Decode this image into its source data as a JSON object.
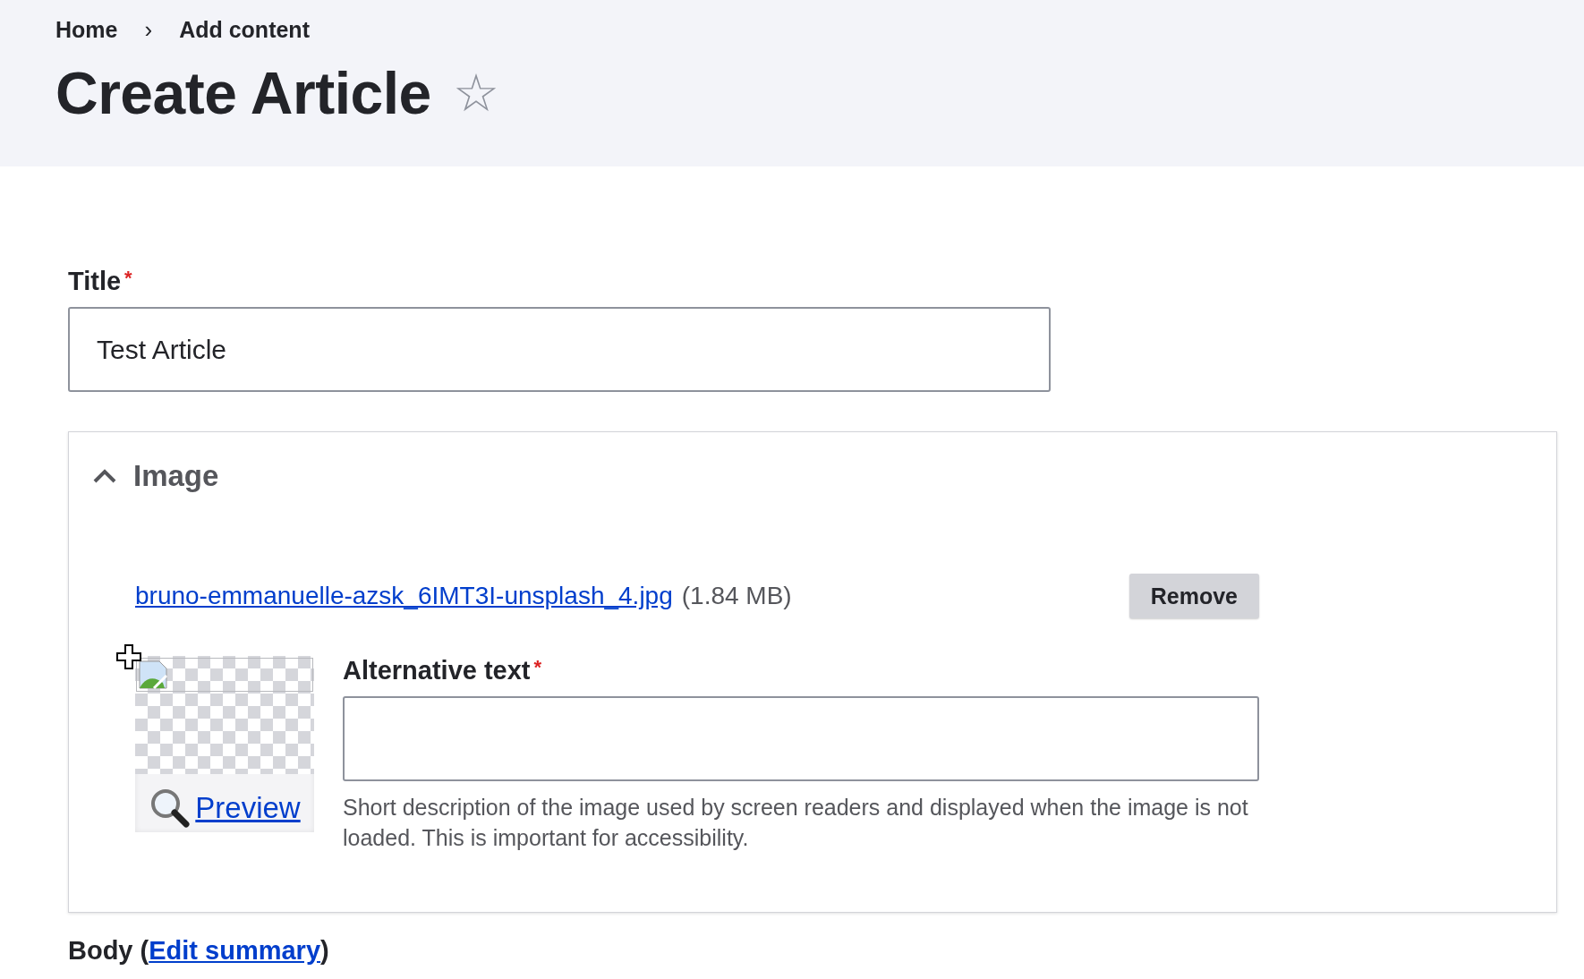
{
  "breadcrumb": [
    "Home",
    "Add content"
  ],
  "breadcrumb_separator": "›",
  "page_title": "Create Article",
  "favorite": {
    "on": false,
    "glyph": "☆"
  },
  "title_field": {
    "label": "Title",
    "required": true,
    "required_mark": "*",
    "value": "Test Article"
  },
  "image_section": {
    "title": "Image",
    "expanded": true,
    "file": {
      "name": "bruno-emmanuelle-azsk_6IMT3I-unsplash_4.jpg",
      "size": "(1.84 MB)"
    },
    "remove_button": "Remove",
    "preview_link": "Preview",
    "alt_text": {
      "label": "Alternative text",
      "required": true,
      "required_mark": "*",
      "description": "Short description of the image used by screen readers and displayed when the image is not loaded. This is important for accessibility."
    }
  },
  "body": {
    "label": "Body (",
    "link": "Edit summary",
    "close": ")"
  }
}
